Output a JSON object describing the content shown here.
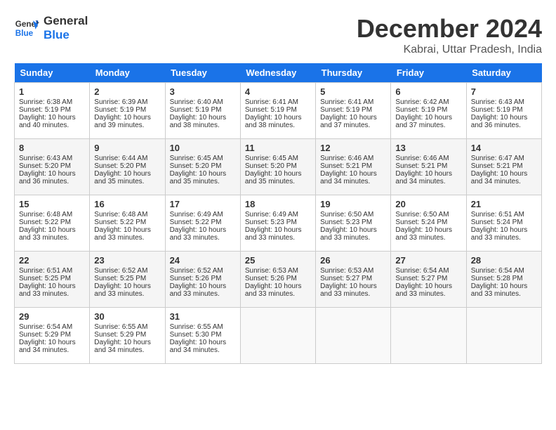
{
  "logo": {
    "line1": "General",
    "line2": "Blue"
  },
  "title": "December 2024",
  "location": "Kabrai, Uttar Pradesh, India",
  "days_of_week": [
    "Sunday",
    "Monday",
    "Tuesday",
    "Wednesday",
    "Thursday",
    "Friday",
    "Saturday"
  ],
  "weeks": [
    [
      {
        "day": "1",
        "sunrise": "6:38 AM",
        "sunset": "5:19 PM",
        "daylight": "10 hours and 40 minutes."
      },
      {
        "day": "2",
        "sunrise": "6:39 AM",
        "sunset": "5:19 PM",
        "daylight": "10 hours and 39 minutes."
      },
      {
        "day": "3",
        "sunrise": "6:40 AM",
        "sunset": "5:19 PM",
        "daylight": "10 hours and 38 minutes."
      },
      {
        "day": "4",
        "sunrise": "6:41 AM",
        "sunset": "5:19 PM",
        "daylight": "10 hours and 38 minutes."
      },
      {
        "day": "5",
        "sunrise": "6:41 AM",
        "sunset": "5:19 PM",
        "daylight": "10 hours and 37 minutes."
      },
      {
        "day": "6",
        "sunrise": "6:42 AM",
        "sunset": "5:19 PM",
        "daylight": "10 hours and 37 minutes."
      },
      {
        "day": "7",
        "sunrise": "6:43 AM",
        "sunset": "5:19 PM",
        "daylight": "10 hours and 36 minutes."
      }
    ],
    [
      {
        "day": "8",
        "sunrise": "6:43 AM",
        "sunset": "5:20 PM",
        "daylight": "10 hours and 36 minutes."
      },
      {
        "day": "9",
        "sunrise": "6:44 AM",
        "sunset": "5:20 PM",
        "daylight": "10 hours and 35 minutes."
      },
      {
        "day": "10",
        "sunrise": "6:45 AM",
        "sunset": "5:20 PM",
        "daylight": "10 hours and 35 minutes."
      },
      {
        "day": "11",
        "sunrise": "6:45 AM",
        "sunset": "5:20 PM",
        "daylight": "10 hours and 35 minutes."
      },
      {
        "day": "12",
        "sunrise": "6:46 AM",
        "sunset": "5:21 PM",
        "daylight": "10 hours and 34 minutes."
      },
      {
        "day": "13",
        "sunrise": "6:46 AM",
        "sunset": "5:21 PM",
        "daylight": "10 hours and 34 minutes."
      },
      {
        "day": "14",
        "sunrise": "6:47 AM",
        "sunset": "5:21 PM",
        "daylight": "10 hours and 34 minutes."
      }
    ],
    [
      {
        "day": "15",
        "sunrise": "6:48 AM",
        "sunset": "5:22 PM",
        "daylight": "10 hours and 33 minutes."
      },
      {
        "day": "16",
        "sunrise": "6:48 AM",
        "sunset": "5:22 PM",
        "daylight": "10 hours and 33 minutes."
      },
      {
        "day": "17",
        "sunrise": "6:49 AM",
        "sunset": "5:22 PM",
        "daylight": "10 hours and 33 minutes."
      },
      {
        "day": "18",
        "sunrise": "6:49 AM",
        "sunset": "5:23 PM",
        "daylight": "10 hours and 33 minutes."
      },
      {
        "day": "19",
        "sunrise": "6:50 AM",
        "sunset": "5:23 PM",
        "daylight": "10 hours and 33 minutes."
      },
      {
        "day": "20",
        "sunrise": "6:50 AM",
        "sunset": "5:24 PM",
        "daylight": "10 hours and 33 minutes."
      },
      {
        "day": "21",
        "sunrise": "6:51 AM",
        "sunset": "5:24 PM",
        "daylight": "10 hours and 33 minutes."
      }
    ],
    [
      {
        "day": "22",
        "sunrise": "6:51 AM",
        "sunset": "5:25 PM",
        "daylight": "10 hours and 33 minutes."
      },
      {
        "day": "23",
        "sunrise": "6:52 AM",
        "sunset": "5:25 PM",
        "daylight": "10 hours and 33 minutes."
      },
      {
        "day": "24",
        "sunrise": "6:52 AM",
        "sunset": "5:26 PM",
        "daylight": "10 hours and 33 minutes."
      },
      {
        "day": "25",
        "sunrise": "6:53 AM",
        "sunset": "5:26 PM",
        "daylight": "10 hours and 33 minutes."
      },
      {
        "day": "26",
        "sunrise": "6:53 AM",
        "sunset": "5:27 PM",
        "daylight": "10 hours and 33 minutes."
      },
      {
        "day": "27",
        "sunrise": "6:54 AM",
        "sunset": "5:27 PM",
        "daylight": "10 hours and 33 minutes."
      },
      {
        "day": "28",
        "sunrise": "6:54 AM",
        "sunset": "5:28 PM",
        "daylight": "10 hours and 33 minutes."
      }
    ],
    [
      {
        "day": "29",
        "sunrise": "6:54 AM",
        "sunset": "5:29 PM",
        "daylight": "10 hours and 34 minutes."
      },
      {
        "day": "30",
        "sunrise": "6:55 AM",
        "sunset": "5:29 PM",
        "daylight": "10 hours and 34 minutes."
      },
      {
        "day": "31",
        "sunrise": "6:55 AM",
        "sunset": "5:30 PM",
        "daylight": "10 hours and 34 minutes."
      },
      null,
      null,
      null,
      null
    ]
  ],
  "labels": {
    "sunrise": "Sunrise:",
    "sunset": "Sunset:",
    "daylight": "Daylight:"
  }
}
